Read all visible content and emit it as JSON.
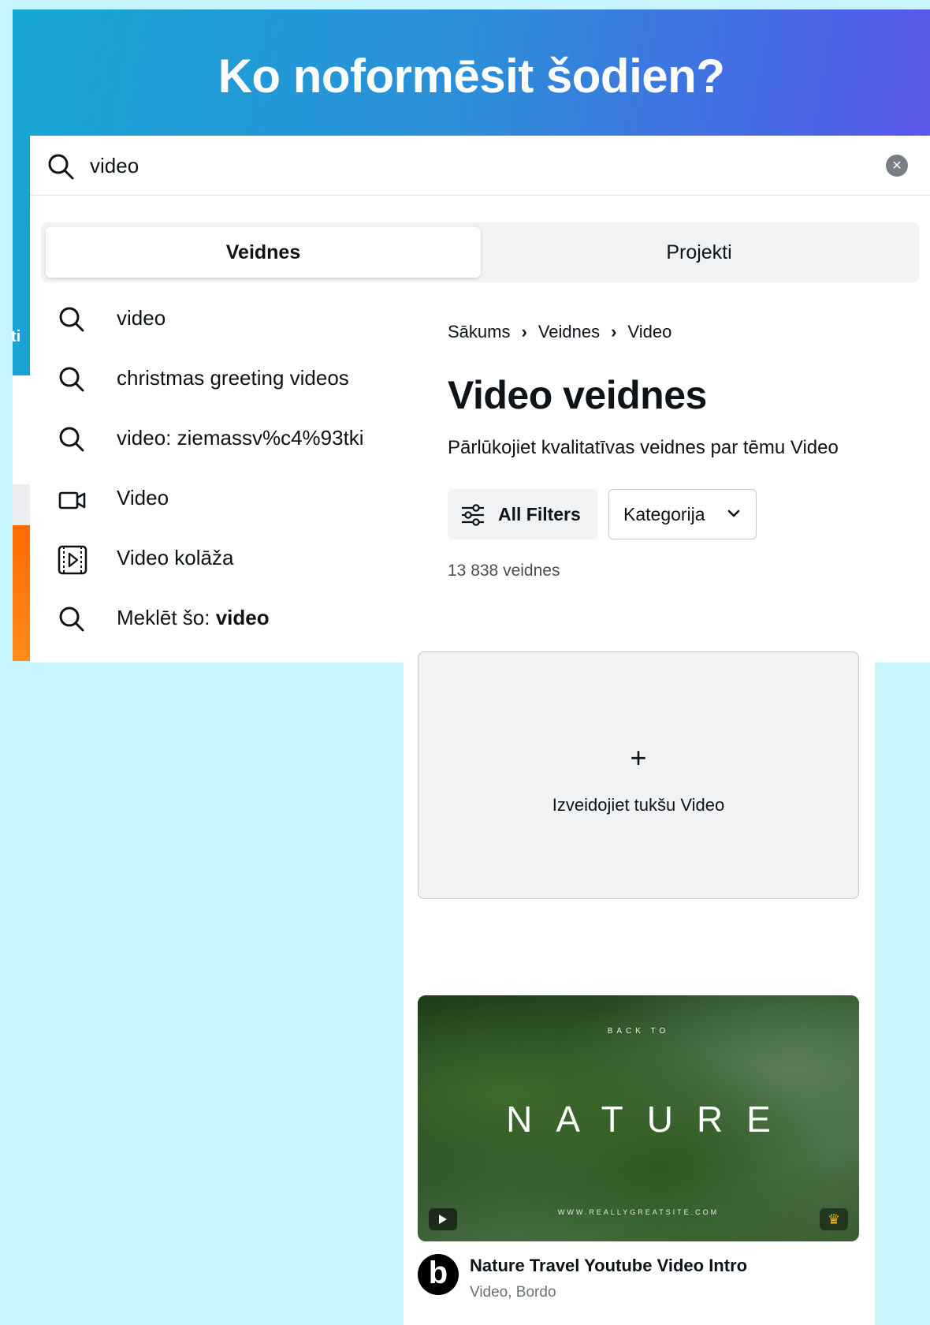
{
  "banner": {
    "title": "Ko noformēsit šodien?"
  },
  "sidebar_partial": {
    "label": "ti"
  },
  "search": {
    "value": "video",
    "clear_icon": "×"
  },
  "tabs": [
    {
      "label": "Veidnes",
      "active": true
    },
    {
      "label": "Projekti",
      "active": false
    }
  ],
  "suggestions": [
    {
      "icon": "search-icon",
      "label": "video"
    },
    {
      "icon": "search-icon",
      "label": "christmas greeting videos"
    },
    {
      "icon": "search-icon",
      "label": "video: ziemassv%c4%93tki"
    },
    {
      "icon": "video-camera-icon",
      "label": "Video"
    },
    {
      "icon": "video-collage-icon",
      "label": "Video kolāža"
    },
    {
      "icon": "search-icon",
      "label_prefix": "Meklēt šo: ",
      "label_bold": "video"
    }
  ],
  "breadcrumb": {
    "items": [
      "Sākums",
      "Veidnes",
      "Video"
    ],
    "separator": "›"
  },
  "page": {
    "title": "Video veidnes",
    "subtitle": "Pārlūkojiet kvalitatīvas veidnes par tēmu Video",
    "filters_label": "All Filters",
    "category_label": "Kategorija",
    "count": "13 838 veidnes"
  },
  "blank_card": {
    "plus": "+",
    "label": "Izveidojiet tukšu Video"
  },
  "template_card": {
    "thumb_small": "BACK TO",
    "thumb_big": "NATURE",
    "thumb_url": "WWW.REALLYGREATSITE.COM",
    "avatar_letter": "b",
    "title": "Nature Travel Youtube Video Intro",
    "meta": "Video, Bordo"
  },
  "colors": {
    "accent": "#7d2ae8",
    "banner_start": "#16a6d3",
    "banner_end": "#6a4ee9",
    "background": "#c8f4fd"
  }
}
